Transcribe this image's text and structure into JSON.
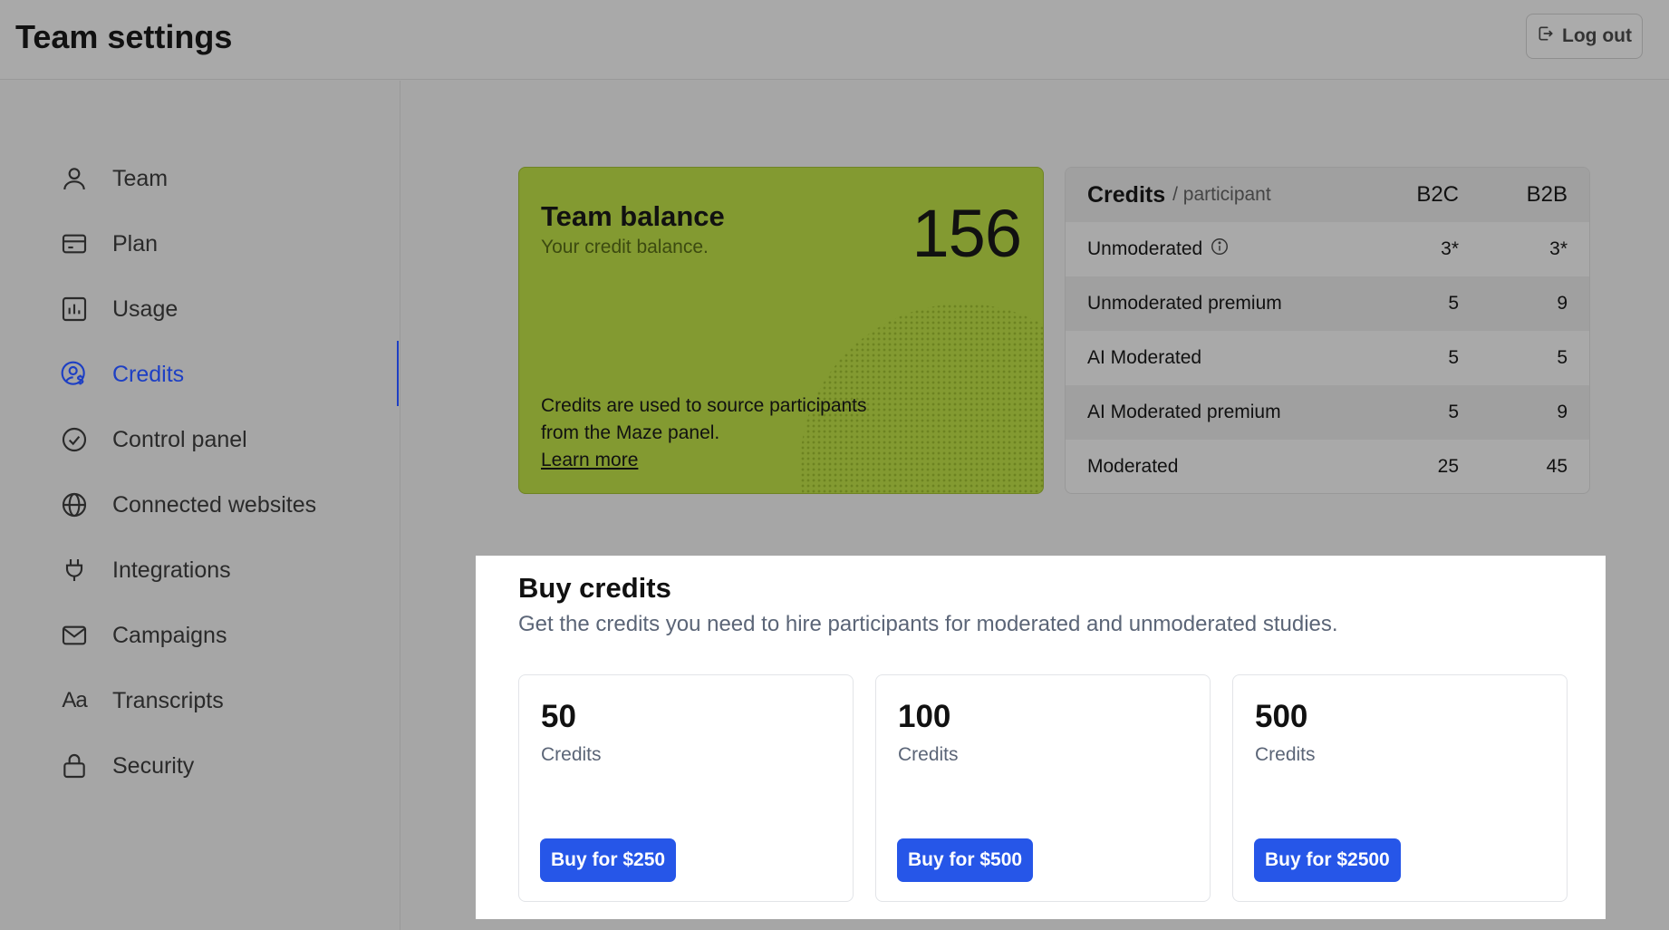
{
  "header": {
    "title": "Team settings",
    "logout_label": "Log out"
  },
  "sidebar": {
    "items": [
      {
        "label": "Team",
        "icon": "user-icon"
      },
      {
        "label": "Plan",
        "icon": "credit-card-icon"
      },
      {
        "label": "Usage",
        "icon": "bar-chart-icon"
      },
      {
        "label": "Credits",
        "icon": "user-dollar-icon",
        "active": true
      },
      {
        "label": "Control panel",
        "icon": "check-circle-icon"
      },
      {
        "label": "Connected websites",
        "icon": "globe-icon"
      },
      {
        "label": "Integrations",
        "icon": "plug-icon"
      },
      {
        "label": "Campaigns",
        "icon": "mail-icon"
      },
      {
        "label": "Transcripts",
        "icon": "text-aa-icon",
        "glyph": "Aa"
      },
      {
        "label": "Security",
        "icon": "lock-icon"
      }
    ]
  },
  "balance": {
    "title": "Team balance",
    "subtitle": "Your credit balance.",
    "value": "156",
    "description": "Credits are used to source participants from the Maze panel.",
    "link": "Learn more",
    "color": "#839a31"
  },
  "credits_table": {
    "title": "Credits",
    "subtitle": "/ participant",
    "col_b2c": "B2C",
    "col_b2b": "B2B",
    "rows": [
      {
        "label": "Unmoderated",
        "b2c": "3*",
        "b2b": "3*",
        "info": true
      },
      {
        "label": "Unmoderated premium",
        "b2c": "5",
        "b2b": "9"
      },
      {
        "label": "AI Moderated",
        "b2c": "5",
        "b2b": "5"
      },
      {
        "label": "AI Moderated premium",
        "b2c": "5",
        "b2b": "9"
      },
      {
        "label": "Moderated",
        "b2c": "25",
        "b2b": "45"
      }
    ]
  },
  "buy": {
    "title": "Buy credits",
    "subtitle": "Get the credits you need to hire participants for moderated and unmoderated studies.",
    "packages": [
      {
        "amount": "50",
        "unit": "Credits",
        "button": "Buy for $250"
      },
      {
        "amount": "100",
        "unit": "Credits",
        "button": "Buy for $500"
      },
      {
        "amount": "500",
        "unit": "Credits",
        "button": "Buy for $2500"
      }
    ],
    "accent": "#2656e8"
  }
}
